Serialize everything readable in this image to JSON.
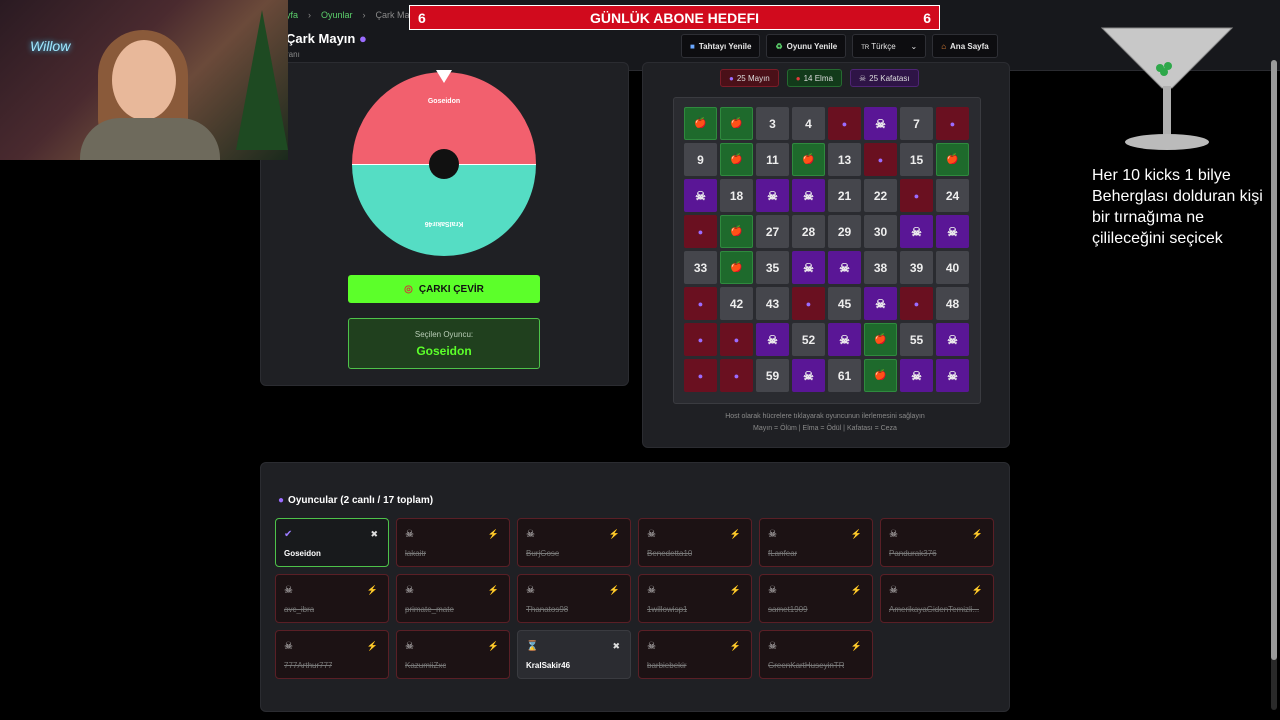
{
  "banner": {
    "left_num": "6",
    "title": "GÜNLÜK ABONE HEDEFI",
    "right_num": "6"
  },
  "breadcrumb": {
    "home": "yfa",
    "games": "Oyunlar",
    "current": "Çark Mayın"
  },
  "page": {
    "title": "Çark Mayın",
    "subtitle": "ranı"
  },
  "nav": {
    "reset_board": "Tahtayı Yenile",
    "reset_game": "Oyunu Yenile",
    "language": "Türkçe",
    "home": "Ana Sayfa"
  },
  "wheel": {
    "top_label": "Goseidon",
    "bottom_label": "KralSakir46",
    "spin_label": "ÇARKI ÇEVİR"
  },
  "selected": {
    "label": "Seçilen Oyuncu:",
    "value": "Goseidon"
  },
  "chips": {
    "mines": "25 Mayın",
    "apples": "14 Elma",
    "skulls": "25 Kafatası"
  },
  "board": {
    "cells": [
      {
        "t": "apple",
        "v": ""
      },
      {
        "t": "apple",
        "v": ""
      },
      {
        "t": "num",
        "v": "3"
      },
      {
        "t": "num",
        "v": "4"
      },
      {
        "t": "mine",
        "v": ""
      },
      {
        "t": "skull",
        "v": ""
      },
      {
        "t": "num",
        "v": "7"
      },
      {
        "t": "mine",
        "v": ""
      },
      {
        "t": "num",
        "v": "9"
      },
      {
        "t": "apple",
        "v": ""
      },
      {
        "t": "num",
        "v": "11"
      },
      {
        "t": "apple",
        "v": ""
      },
      {
        "t": "num",
        "v": "13"
      },
      {
        "t": "mine",
        "v": ""
      },
      {
        "t": "num",
        "v": "15"
      },
      {
        "t": "apple",
        "v": ""
      },
      {
        "t": "skull",
        "v": ""
      },
      {
        "t": "num",
        "v": "18"
      },
      {
        "t": "skull",
        "v": ""
      },
      {
        "t": "skull",
        "v": ""
      },
      {
        "t": "num",
        "v": "21"
      },
      {
        "t": "num",
        "v": "22"
      },
      {
        "t": "mine",
        "v": ""
      },
      {
        "t": "num",
        "v": "24"
      },
      {
        "t": "mine",
        "v": ""
      },
      {
        "t": "apple",
        "v": ""
      },
      {
        "t": "num",
        "v": "27"
      },
      {
        "t": "num",
        "v": "28"
      },
      {
        "t": "num",
        "v": "29"
      },
      {
        "t": "num",
        "v": "30"
      },
      {
        "t": "skull",
        "v": ""
      },
      {
        "t": "skull",
        "v": ""
      },
      {
        "t": "num",
        "v": "33"
      },
      {
        "t": "apple",
        "v": ""
      },
      {
        "t": "num",
        "v": "35"
      },
      {
        "t": "skull",
        "v": ""
      },
      {
        "t": "skull",
        "v": ""
      },
      {
        "t": "num",
        "v": "38"
      },
      {
        "t": "num",
        "v": "39"
      },
      {
        "t": "num",
        "v": "40"
      },
      {
        "t": "mine",
        "v": ""
      },
      {
        "t": "num",
        "v": "42"
      },
      {
        "t": "num",
        "v": "43"
      },
      {
        "t": "mine",
        "v": ""
      },
      {
        "t": "num",
        "v": "45"
      },
      {
        "t": "skull",
        "v": ""
      },
      {
        "t": "mine",
        "v": ""
      },
      {
        "t": "num",
        "v": "48"
      },
      {
        "t": "mine",
        "v": ""
      },
      {
        "t": "mine",
        "v": ""
      },
      {
        "t": "skull",
        "v": ""
      },
      {
        "t": "num",
        "v": "52"
      },
      {
        "t": "skull",
        "v": ""
      },
      {
        "t": "apple",
        "v": ""
      },
      {
        "t": "num",
        "v": "55"
      },
      {
        "t": "skull",
        "v": ""
      },
      {
        "t": "mine",
        "v": ""
      },
      {
        "t": "mine",
        "v": ""
      },
      {
        "t": "num",
        "v": "59"
      },
      {
        "t": "skull",
        "v": ""
      },
      {
        "t": "num",
        "v": "61"
      },
      {
        "t": "apple",
        "v": ""
      },
      {
        "t": "skull",
        "v": ""
      },
      {
        "t": "skull",
        "v": ""
      }
    ]
  },
  "legend": {
    "line1": "Host olarak hücrelere tıklayarak oyuncunun ilerlemesini sağlayın",
    "line2": "Mayın = Ölüm | Elma = Ödül | Kafatası = Ceza"
  },
  "players": {
    "title": "Oyuncular (2 canlı / 17 toplam)",
    "list": [
      {
        "name": "Goseidon",
        "state": "alive"
      },
      {
        "name": "lakaitr",
        "state": "dead"
      },
      {
        "name": "BurjGose",
        "state": "dead"
      },
      {
        "name": "Benedetta10",
        "state": "dead"
      },
      {
        "name": "fLanfear",
        "state": "dead"
      },
      {
        "name": "Pandurak376",
        "state": "dead"
      },
      {
        "name": "avc_ibra",
        "state": "dead"
      },
      {
        "name": "primate_mate",
        "state": "dead"
      },
      {
        "name": "Thanatos98",
        "state": "dead"
      },
      {
        "name": "1willowisp1",
        "state": "dead"
      },
      {
        "name": "samet1909",
        "state": "dead"
      },
      {
        "name": "AmerikayaGidenTemizli...",
        "state": "dead"
      },
      {
        "name": "777Arthur777",
        "state": "dead"
      },
      {
        "name": "KazumiiZxc",
        "state": "dead"
      },
      {
        "name": "KralSakir46",
        "state": "wait"
      },
      {
        "name": "barbiebekir",
        "state": "dead"
      },
      {
        "name": "GreenKartHuseyinTR",
        "state": "dead"
      }
    ]
  },
  "overlay": {
    "text": "Her 10 kicks 1 bilye Beherglası dolduran kişi bir tırnağıma ne çilileceğini seçicek"
  },
  "webcam": {
    "sign": "Willow"
  },
  "colors": {
    "accent_green": "#5cff2a",
    "banner_red": "#d10a1d",
    "wheel_red": "#f2606e",
    "wheel_teal": "#55ddc4"
  }
}
